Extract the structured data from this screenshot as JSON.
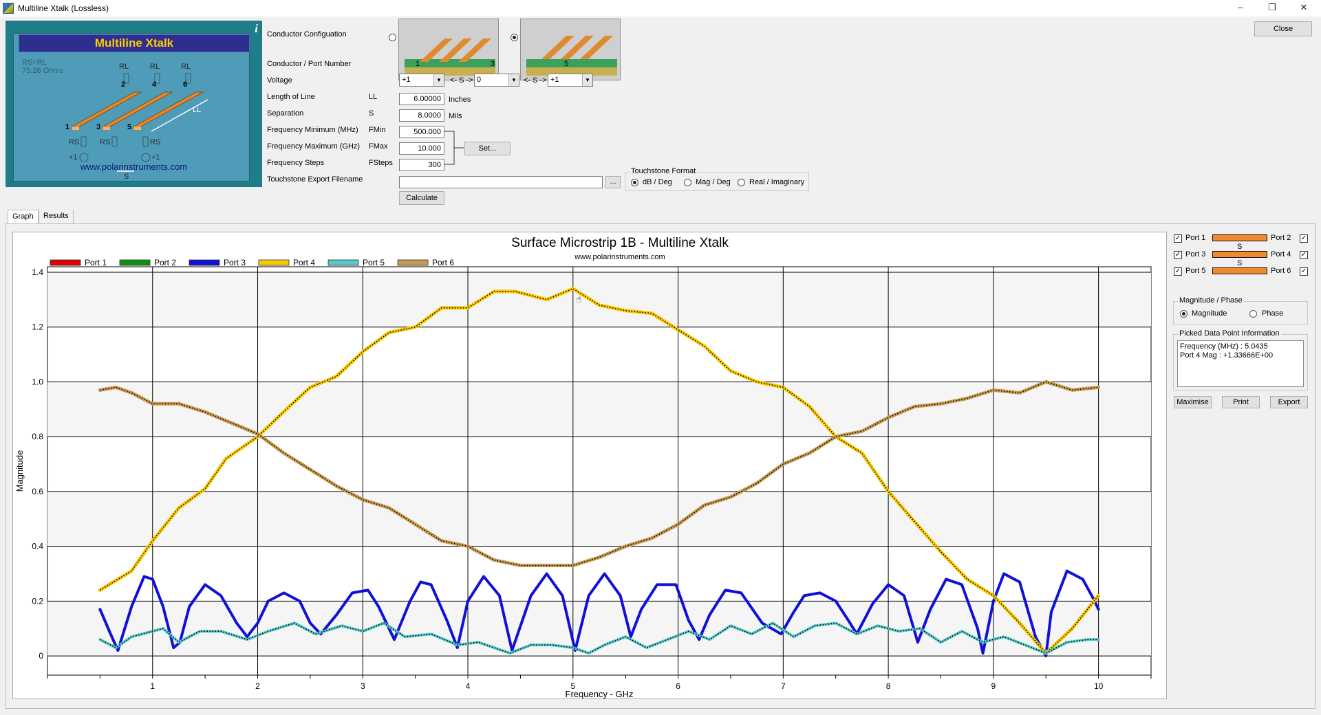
{
  "window": {
    "title": "Multiline Xtalk (Lossless)"
  },
  "logo": {
    "title": "Multiline Xtalk",
    "rs_line1": "RS=RL",
    "rs_line2": "75.26 Ohms",
    "url": "www.polarinstruments.com",
    "labels": {
      "rl1": "RL",
      "rl2": "RL",
      "rl3": "RL",
      "n1": "1",
      "n2": "2",
      "n3": "3",
      "n4": "4",
      "n5": "5",
      "n6": "6",
      "ll": "LL",
      "rs1": "RS",
      "rs2": "RS",
      "rs3": "RS",
      "src1": "+1",
      "src2": "+1",
      "s": "S"
    }
  },
  "form": {
    "conductor_config_label": "Conductor Configuation",
    "conductor_port_label": "Conductor / Port Number",
    "port_numbers": [
      "1",
      "3",
      "5"
    ],
    "voltage_label": "Voltage",
    "voltage_values": [
      "+1",
      "0",
      "+1"
    ],
    "sep_marker": "<- S ->",
    "length_label": "Length of Line",
    "length_sym": "LL",
    "length_value": "6.00000",
    "length_unit": "Inches",
    "separation_label": "Separation",
    "separation_sym": "S",
    "separation_value": "8.0000",
    "separation_unit": "Mils",
    "fmin_label": "Frequency Minimum (MHz)",
    "fmin_sym": "FMin",
    "fmin_value": "500.000",
    "fmax_label": "Frequency Maximum (GHz)",
    "fmax_sym": "FMax",
    "fmax_value": "10.000",
    "fsteps_label": "Frequency Steps",
    "fsteps_sym": "FSteps",
    "fsteps_value": "300",
    "touchstone_label": "Touchstone Export Filename",
    "touchstone_value": "",
    "browse_label": "...",
    "set_button": "Set...",
    "calculate_button": "Calculate",
    "touchstone_format": {
      "title": "Touchstone Format",
      "options": [
        "dB / Deg",
        "Mag / Deg",
        "Real / Imaginary"
      ],
      "selected": "dB / Deg"
    }
  },
  "close_button": "Close",
  "tabs": [
    "Graph",
    "Results"
  ],
  "side": {
    "ports_left": [
      "Port 1",
      "Port 3",
      "Port 5"
    ],
    "ports_right": [
      "Port 2",
      "Port 4",
      "Port 6"
    ],
    "s_marker": "S",
    "mag_phase": {
      "title": "Magnitude / Phase",
      "options": [
        "Magnitude",
        "Phase"
      ],
      "selected": "Magnitude"
    },
    "picked": {
      "title": "Picked Data Point Information",
      "line1": "Frequency (MHz) : 5.0435",
      "line2": "Port 4 Mag : +1.33666E+00"
    },
    "buttons": {
      "maximise": "Maximise",
      "print": "Print",
      "export": "Export"
    }
  },
  "chart_data": {
    "type": "line",
    "title": "Surface Microstrip 1B - Multiline Xtalk",
    "subtitle": "www.polarinstruments.com",
    "xlabel": "Frequency - GHz",
    "ylabel": "Magnitude",
    "xlim": [
      0,
      10.5
    ],
    "ylim": [
      -0.07,
      1.42
    ],
    "xticks": [
      1,
      2,
      3,
      4,
      5,
      6,
      7,
      8,
      9,
      10
    ],
    "yticks": [
      0,
      0.2,
      0.4,
      0.6,
      0.8,
      1.0,
      1.2,
      1.4
    ],
    "ytick_labels": [
      "0",
      "0.2",
      "0.4",
      "0.6",
      "0.8",
      "1.0",
      "1.2",
      "1.4"
    ],
    "grid": true,
    "legend": "top",
    "series": [
      {
        "name": "Port 1",
        "color": "#e00000",
        "x": [],
        "y": []
      },
      {
        "name": "Port 2",
        "color": "#109010",
        "x": [],
        "y": []
      },
      {
        "name": "Port 3",
        "color": "#1010d8",
        "width": 4,
        "x": [
          0.5,
          0.6,
          0.67,
          0.8,
          0.92,
          1.0,
          1.1,
          1.2,
          1.26,
          1.35,
          1.5,
          1.65,
          1.8,
          1.9,
          2.0,
          2.1,
          2.25,
          2.4,
          2.5,
          2.6,
          2.75,
          2.9,
          3.05,
          3.15,
          3.3,
          3.45,
          3.55,
          3.65,
          3.8,
          3.9,
          4.0,
          4.15,
          4.3,
          4.42,
          4.6,
          4.75,
          4.9,
          5.02,
          5.15,
          5.3,
          5.45,
          5.55,
          5.65,
          5.8,
          5.98,
          6.1,
          6.2,
          6.3,
          6.45,
          6.6,
          6.8,
          6.98,
          7.1,
          7.2,
          7.35,
          7.5,
          7.62,
          7.7,
          7.85,
          8.0,
          8.15,
          8.28,
          8.4,
          8.55,
          8.7,
          8.85,
          8.9,
          9.0,
          9.1,
          9.25,
          9.4,
          9.5,
          9.55,
          9.7,
          9.85,
          9.95,
          10.0
        ],
        "y": [
          0.17,
          0.08,
          0.02,
          0.18,
          0.29,
          0.28,
          0.18,
          0.03,
          0.05,
          0.18,
          0.26,
          0.22,
          0.12,
          0.07,
          0.12,
          0.2,
          0.23,
          0.2,
          0.12,
          0.08,
          0.15,
          0.23,
          0.24,
          0.18,
          0.06,
          0.2,
          0.27,
          0.26,
          0.13,
          0.03,
          0.2,
          0.29,
          0.22,
          0.02,
          0.22,
          0.3,
          0.22,
          0.02,
          0.22,
          0.3,
          0.22,
          0.07,
          0.17,
          0.26,
          0.26,
          0.13,
          0.06,
          0.15,
          0.24,
          0.23,
          0.12,
          0.08,
          0.16,
          0.22,
          0.23,
          0.2,
          0.13,
          0.08,
          0.19,
          0.26,
          0.22,
          0.05,
          0.17,
          0.28,
          0.26,
          0.1,
          0.01,
          0.2,
          0.3,
          0.27,
          0.07,
          0.0,
          0.16,
          0.31,
          0.28,
          0.21,
          0.17
        ]
      },
      {
        "name": "Port 4",
        "color": "#f8c800",
        "width": 5,
        "x": [
          0.5,
          0.8,
          1.0,
          1.25,
          1.5,
          1.7,
          2.0,
          2.3,
          2.5,
          2.75,
          3.0,
          3.25,
          3.5,
          3.75,
          4.0,
          4.25,
          4.45,
          4.75,
          5.0,
          5.25,
          5.5,
          5.75,
          6.0,
          6.25,
          6.5,
          6.75,
          7.0,
          7.25,
          7.5,
          7.75,
          8.0,
          8.25,
          8.5,
          8.75,
          9.0,
          9.25,
          9.5,
          9.75,
          10.0
        ],
        "y": [
          0.24,
          0.31,
          0.42,
          0.54,
          0.61,
          0.72,
          0.8,
          0.91,
          0.98,
          1.02,
          1.11,
          1.18,
          1.2,
          1.27,
          1.27,
          1.33,
          1.33,
          1.3,
          1.34,
          1.28,
          1.26,
          1.25,
          1.19,
          1.13,
          1.04,
          1.0,
          0.98,
          0.91,
          0.8,
          0.74,
          0.6,
          0.49,
          0.38,
          0.28,
          0.22,
          0.12,
          0.01,
          0.1,
          0.22
        ]
      },
      {
        "name": "Port 5",
        "color": "#55c8c8",
        "width": 4,
        "x": [
          0.5,
          0.65,
          0.8,
          1.0,
          1.1,
          1.25,
          1.45,
          1.65,
          1.9,
          2.1,
          2.35,
          2.55,
          2.8,
          3.0,
          3.2,
          3.4,
          3.65,
          3.9,
          4.1,
          4.25,
          4.4,
          4.6,
          4.8,
          5.0,
          5.15,
          5.3,
          5.5,
          5.7,
          5.9,
          6.1,
          6.3,
          6.5,
          6.7,
          6.9,
          7.1,
          7.3,
          7.5,
          7.7,
          7.9,
          8.1,
          8.3,
          8.5,
          8.7,
          8.9,
          9.1,
          9.3,
          9.5,
          9.7,
          9.9,
          10.0
        ],
        "y": [
          0.06,
          0.03,
          0.07,
          0.09,
          0.1,
          0.05,
          0.09,
          0.09,
          0.06,
          0.09,
          0.12,
          0.08,
          0.11,
          0.09,
          0.12,
          0.07,
          0.08,
          0.04,
          0.05,
          0.03,
          0.01,
          0.04,
          0.04,
          0.03,
          0.01,
          0.04,
          0.07,
          0.03,
          0.06,
          0.09,
          0.06,
          0.11,
          0.08,
          0.12,
          0.07,
          0.11,
          0.12,
          0.08,
          0.11,
          0.09,
          0.1,
          0.05,
          0.09,
          0.05,
          0.07,
          0.04,
          0.01,
          0.05,
          0.06,
          0.06
        ]
      },
      {
        "name": "Port 6",
        "color": "#c89a50",
        "width": 5,
        "x": [
          0.5,
          0.65,
          0.8,
          1.0,
          1.25,
          1.5,
          1.75,
          2.0,
          2.25,
          2.5,
          2.75,
          3.0,
          3.25,
          3.5,
          3.75,
          4.0,
          4.25,
          4.5,
          4.75,
          5.0,
          5.25,
          5.5,
          5.75,
          6.0,
          6.25,
          6.5,
          6.75,
          7.0,
          7.25,
          7.5,
          7.75,
          8.0,
          8.25,
          8.5,
          8.75,
          9.0,
          9.25,
          9.5,
          9.75,
          10.0
        ],
        "y": [
          0.97,
          0.98,
          0.96,
          0.92,
          0.92,
          0.89,
          0.85,
          0.81,
          0.74,
          0.68,
          0.62,
          0.57,
          0.54,
          0.48,
          0.42,
          0.4,
          0.35,
          0.33,
          0.33,
          0.33,
          0.36,
          0.4,
          0.43,
          0.48,
          0.55,
          0.58,
          0.63,
          0.7,
          0.74,
          0.8,
          0.82,
          0.87,
          0.91,
          0.92,
          0.94,
          0.97,
          0.96,
          1.0,
          0.97,
          0.98
        ]
      }
    ]
  }
}
